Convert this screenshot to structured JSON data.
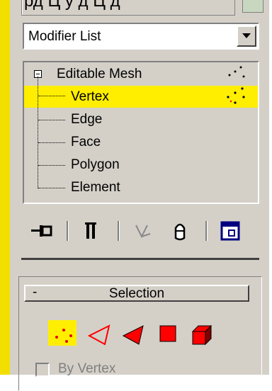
{
  "top": {
    "partial_text": "рд  Ц  у  д  Ц  д"
  },
  "modifier_dropdown": {
    "label": "Modifier List"
  },
  "stack": {
    "items": [
      {
        "label": "Editable Mesh",
        "selected": false,
        "expanded": true
      },
      {
        "label": "Vertex",
        "selected": true
      },
      {
        "label": "Edge",
        "selected": false
      },
      {
        "label": "Face",
        "selected": false
      },
      {
        "label": "Polygon",
        "selected": false
      },
      {
        "label": "Element",
        "selected": false
      }
    ]
  },
  "toolbar": {
    "icons": [
      "pin-stack-icon",
      "show-end-result-icon",
      "make-unique-icon",
      "remove-modifier-icon",
      "configure-modifier-sets-icon"
    ]
  },
  "selection_rollout": {
    "collapse_symbol": "-",
    "title": "Selection",
    "levels": [
      {
        "name": "vertex-level-icon",
        "active": true
      },
      {
        "name": "edge-level-icon",
        "active": false
      },
      {
        "name": "face-level-icon",
        "active": false
      },
      {
        "name": "polygon-level-icon",
        "active": false
      },
      {
        "name": "element-level-icon",
        "active": false
      }
    ],
    "by_vertex_label": "By Vertex",
    "by_vertex_checked": false
  },
  "colors": {
    "panel": "#d4d0c8",
    "highlight": "#ffee00",
    "viewport_border": "#f2df00",
    "accent_red": "#ff0000"
  }
}
